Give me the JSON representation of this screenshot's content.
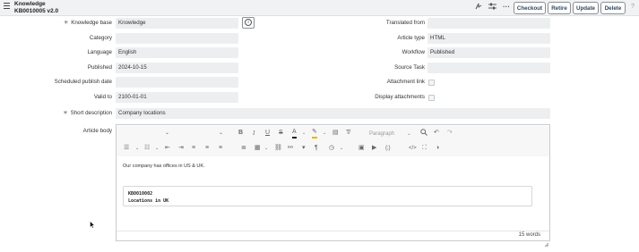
{
  "header": {
    "title": "Knowledge",
    "subtitle": "KB0010005 v2.0",
    "buttons": {
      "checkout": "Checkout",
      "retire": "Retire",
      "update": "Update",
      "delete": "Delete"
    },
    "icons": [
      "hamburger-icon",
      "activity-icon",
      "settings-sliders-icon",
      "more-icon",
      "help-icon"
    ]
  },
  "form": {
    "left": {
      "knowledge_base": {
        "label": "Knowledge base",
        "value": "Knowledge"
      },
      "category": {
        "label": "Category",
        "value": ""
      },
      "language": {
        "label": "Language",
        "value": "English"
      },
      "published": {
        "label": "Published",
        "value": "2024-10-15"
      },
      "scheduled_publish_date": {
        "label": "Scheduled publish date",
        "value": ""
      },
      "valid_to": {
        "label": "Valid to",
        "value": "2100-01-01"
      }
    },
    "right": {
      "translated_from": {
        "label": "Translated from",
        "value": ""
      },
      "article_type": {
        "label": "Article type",
        "value": "HTML"
      },
      "workflow": {
        "label": "Workflow",
        "value": "Published"
      },
      "source_task": {
        "label": "Source Task",
        "value": ""
      },
      "attachment_link": {
        "label": "Attachment link",
        "checked": false
      },
      "display_attachments": {
        "label": "Display attachments",
        "checked": false
      }
    },
    "short_description": {
      "label": "Short description",
      "value": "Company locations"
    },
    "article_body": {
      "label": "Article body"
    }
  },
  "editor": {
    "block_format": "Paragraph",
    "body_text": "Our company has offices in US & UK.",
    "code_lines": [
      "KB0010002",
      "Locations in UK"
    ],
    "word_count": "15 words"
  },
  "colors": {
    "header_bg": "#f1f2f3",
    "field_bg": "#eceef0",
    "button_text": "#30475e"
  }
}
